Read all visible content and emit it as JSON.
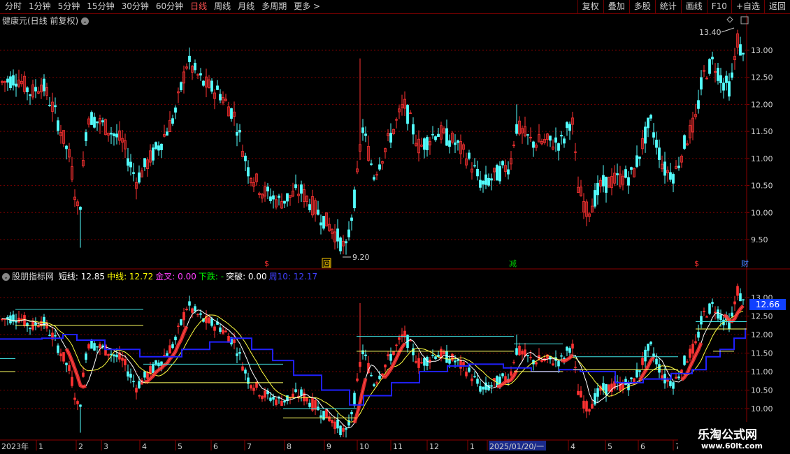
{
  "toolbar": {
    "periods": [
      "分时",
      "1分钟",
      "5分钟",
      "15分钟",
      "30分钟",
      "60分钟",
      "日线",
      "周线",
      "月线",
      "多周期",
      "更多 >"
    ],
    "active_period": "日线",
    "right_buttons": [
      "复权",
      "叠加",
      "多股",
      "统计",
      "画线",
      "F10",
      "+自选",
      "返回"
    ]
  },
  "main_chart": {
    "title": "健康元(日线 前复权)",
    "price_axis": [
      "13.00",
      "12.50",
      "12.00",
      "11.50",
      "11.00",
      "10.50",
      "10.00",
      "9.50"
    ],
    "high_label": "13.40",
    "low_label": "9.20",
    "markers": [
      {
        "label": "$",
        "color": "#ff3030"
      },
      {
        "label": "回",
        "color": "#ffcc00"
      },
      {
        "label": "减",
        "color": "#00cc00"
      },
      {
        "label": "$",
        "color": "#ff3030"
      },
      {
        "label": "财",
        "color": "#4080ff"
      }
    ]
  },
  "indicator": {
    "name": "股朋指标网",
    "items": [
      {
        "label": "短线:",
        "value": "12.85",
        "color": "#ffffff"
      },
      {
        "label": "中线:",
        "value": "12.72",
        "color": "#ffff00"
      },
      {
        "label": "金叉:",
        "value": "0.00",
        "color": "#ff40ff"
      },
      {
        "label": "下跌:",
        "value": "-",
        "color": "#00ff00"
      },
      {
        "label": "突破:",
        "value": "0.00",
        "color": "#ffffff"
      },
      {
        "label": "周10:",
        "value": "12.17",
        "color": "#4040ff"
      }
    ],
    "price_axis": [
      "13.00",
      "12.50",
      "12.00",
      "11.50",
      "11.00",
      "10.50",
      "10.00"
    ],
    "current_price": "12.66"
  },
  "date_axis": [
    "2023年",
    "1",
    "2",
    "3",
    "4",
    "5",
    "6",
    "7",
    "8",
    "9",
    "10",
    "11",
    "12",
    "1",
    "2025/01/20/一",
    "4",
    "5",
    "6",
    "7"
  ],
  "watermark": {
    "line1": "乐淘公式网",
    "line2": "www.60lt.com"
  }
}
